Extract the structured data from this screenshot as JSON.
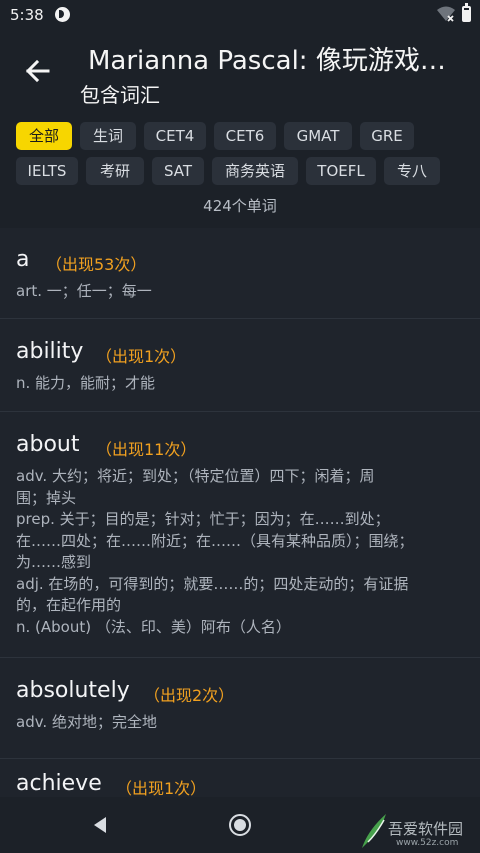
{
  "status_bar": {
    "time": "5:38"
  },
  "header": {
    "title": "Marianna Pascal: 像玩游戏…",
    "subtitle": "包含词汇"
  },
  "filters": [
    "全部",
    "生词",
    "CET4",
    "CET6",
    "GMAT",
    "GRE",
    "IELTS",
    "考研",
    "SAT",
    "商务英语",
    "TOEFL",
    "专八"
  ],
  "active_filter": "全部",
  "word_count": "424个单词",
  "entries": [
    {
      "word": "a",
      "count": "（出现53次）",
      "definitions": [
        "art. 一；任一；每一"
      ]
    },
    {
      "word": "ability",
      "count": "（出现1次）",
      "definitions": [
        "n. 能力，能耐；才能"
      ]
    },
    {
      "word": "about",
      "count": "（出现11次）",
      "definitions": [
        "adv. 大约；将近；到处；（特定位置）四下；闲着；周",
        "围；掉头",
        "prep. 关于；目的是；针对；忙于；因为；在……到处；",
        "在……四处；在……附近；在……（具有某种品质）；围绕；",
        "为……感到",
        "adj. 在场的，可得到的；就要……的；四处走动的；有证据",
        "的，在起作用的",
        "n. (About) （法、印、美）阿布（人名）"
      ]
    },
    {
      "word": "absolutely",
      "count": "（出现2次）",
      "definitions": [
        "adv. 绝对地；完全地"
      ]
    },
    {
      "word": "achieve",
      "count": "（出现1次）",
      "definitions": []
    }
  ],
  "watermark": {
    "text": "吾爱软件园",
    "url": "www.52z.com"
  },
  "colors": {
    "accent": "#f7d600",
    "count": "#f0a020",
    "background": "#1f242c",
    "header": "#1c2128"
  }
}
